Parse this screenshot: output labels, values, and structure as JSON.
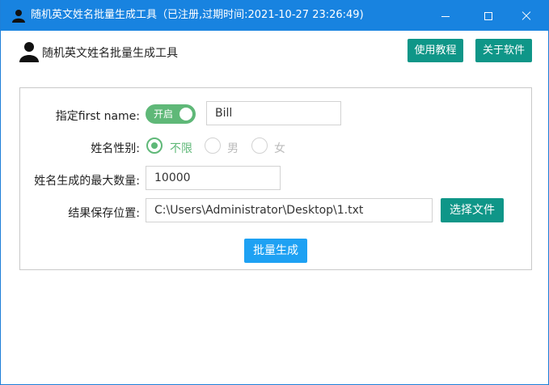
{
  "window": {
    "title": "随机英文姓名批量生成工具（已注册,过期时间:2021-10-27 23:26:49)",
    "icon": "user-icon",
    "controls": {
      "minimize": "minimize-icon",
      "maximize": "maximize-icon",
      "close": "close-icon"
    }
  },
  "header": {
    "app_title": "随机英文姓名批量生成工具",
    "help_button": "使用教程",
    "about_button": "关于软件"
  },
  "form": {
    "first_name_label": "指定first name:",
    "first_name_switch": {
      "label": "开启",
      "on": true
    },
    "first_name_value": "Bill",
    "gender_label": "姓名性别:",
    "gender_options": [
      {
        "label": "不限",
        "checked": true
      },
      {
        "label": "男",
        "checked": false
      },
      {
        "label": "女",
        "checked": false
      }
    ],
    "max_count_label": "姓名生成的最大数量:",
    "max_count_value": "10000",
    "save_path_label": "结果保存位置:",
    "save_path_value": "C:\\Users\\Administrator\\Desktop\\1.txt",
    "choose_file_button": "选择文件",
    "generate_button": "批量生成"
  },
  "colors": {
    "titlebar": "#1883e0",
    "teal_button": "#0f9688",
    "blue_button": "#1ea1f3",
    "switch_on": "#5fb878",
    "radio_checked": "#5fb878"
  }
}
